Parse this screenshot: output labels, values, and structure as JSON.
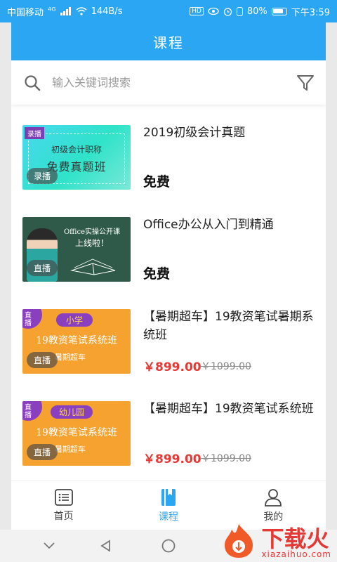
{
  "statusbar": {
    "carrier": "中国移动",
    "signal": "⁴ᴳ",
    "speed": "144B/s",
    "hd_label": "HD",
    "battery": "80%",
    "time": "下午3:59"
  },
  "appbar": {
    "title": "课程"
  },
  "search": {
    "placeholder": "输入关键词搜索"
  },
  "courses": [
    {
      "title": "2019初级会计真题",
      "price_text": "免费",
      "badge": "录播",
      "thumb": {
        "tag": "录播",
        "line1": "初级会计职称",
        "line2": "免费真题班"
      }
    },
    {
      "title": "Office办公从入门到精通",
      "price_text": "免费",
      "badge": "直播",
      "thumb": {
        "line1": "Office实操公开课",
        "line2": "上线啦！"
      }
    },
    {
      "title": "【暑期超车】19教资笔试暑期系统班",
      "price": "￥899.00",
      "original_price": "￥1099.00",
      "badge": "直播",
      "thumb": {
        "tag": "直播",
        "pill": "小学",
        "line1": "19教资笔试系统班",
        "line2": "暑期超车"
      }
    },
    {
      "title": "【暑期超车】19教资笔试系统班",
      "price": "￥899.00",
      "original_price": "￥1099.00",
      "badge": "直播",
      "thumb": {
        "tag": "直播",
        "pill": "幼儿园",
        "line1": "19教资笔试系统班",
        "line2": "暑期超车"
      }
    }
  ],
  "bottomnav": {
    "items": [
      {
        "label": "首页"
      },
      {
        "label": "课程"
      },
      {
        "label": "我的"
      }
    ]
  },
  "watermark": {
    "text": "下载火",
    "sub": "xiazaihuo.com"
  },
  "colors": {
    "primary": "#2aa6f3",
    "price": "#e53935"
  }
}
